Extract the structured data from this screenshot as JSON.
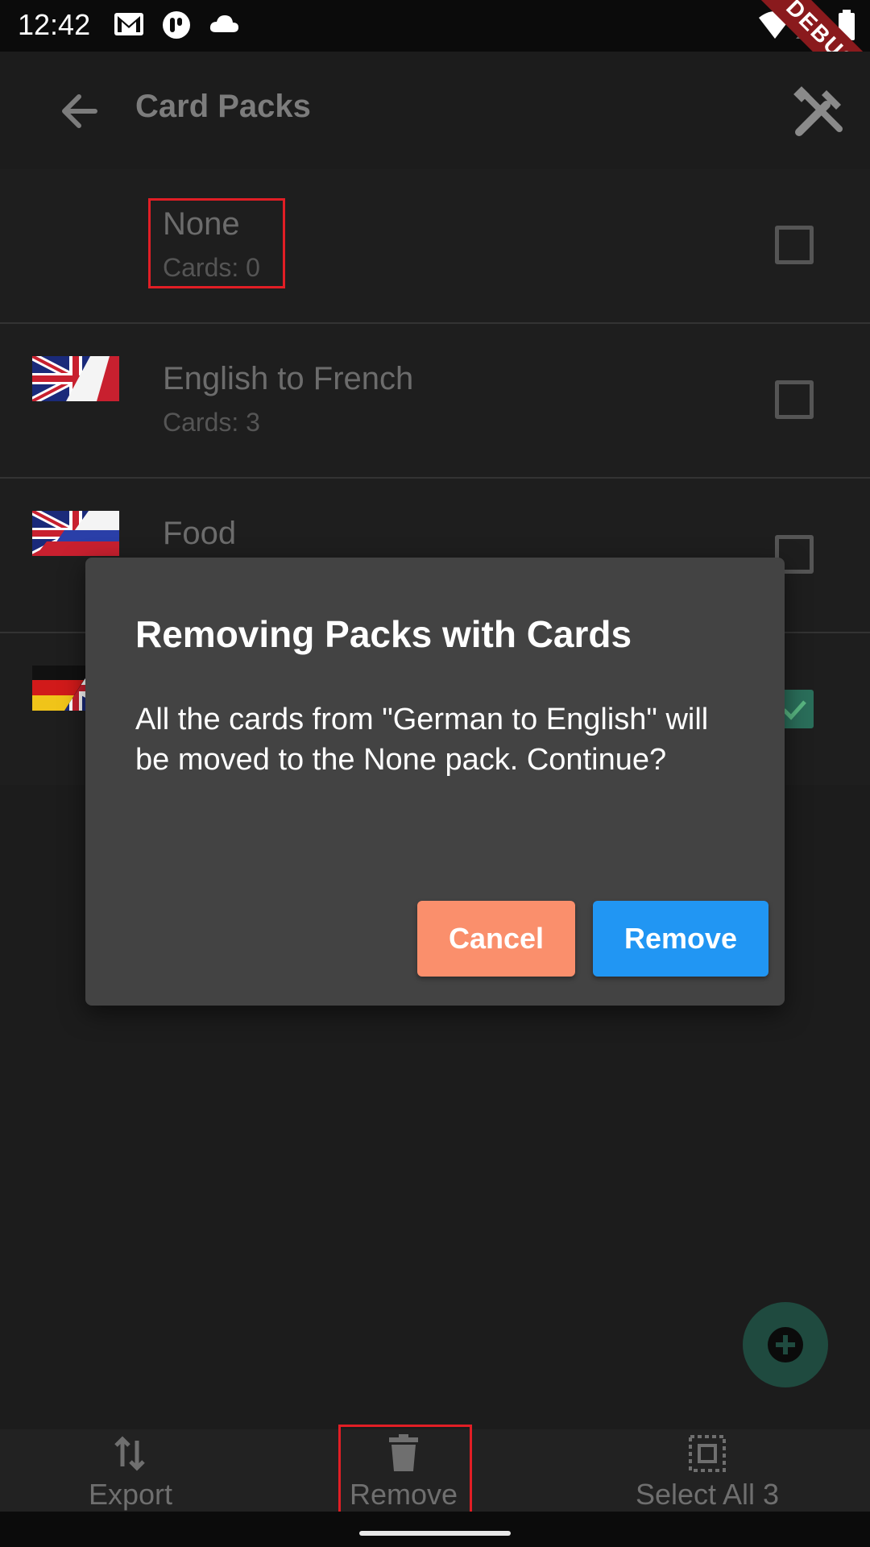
{
  "status_bar": {
    "time": "12:42",
    "icons": [
      "gmail-icon",
      "app-icon",
      "cloud-icon",
      "wifi-icon",
      "signal-icon",
      "battery-icon"
    ],
    "debug_label": "DEBUG"
  },
  "app_bar": {
    "title": "Card Packs"
  },
  "packs": [
    {
      "name": "None",
      "count": "Cards: 0",
      "flag": "none",
      "checked": false
    },
    {
      "name": "English to French",
      "count": "Cards: 3",
      "flag": "uk-fr",
      "checked": false
    },
    {
      "name": "Food",
      "count": "",
      "flag": "uk-ru",
      "checked": false
    },
    {
      "name": "",
      "count": "",
      "flag": "de-uk",
      "checked": true
    }
  ],
  "dialog": {
    "title": "Removing Packs with Cards",
    "body": "All the cards from \"German to English\" will be moved to the None pack. Continue?",
    "cancel_label": "Cancel",
    "remove_label": "Remove"
  },
  "bottom_nav": {
    "export_label": "Export",
    "remove_label": "Remove",
    "select_all_label": "Select All 3"
  },
  "colors": {
    "accent_blue": "#2196f3",
    "cancel_orange": "#fa8f6c",
    "highlight_red": "#e11e25",
    "dialog_bg": "#434343"
  }
}
